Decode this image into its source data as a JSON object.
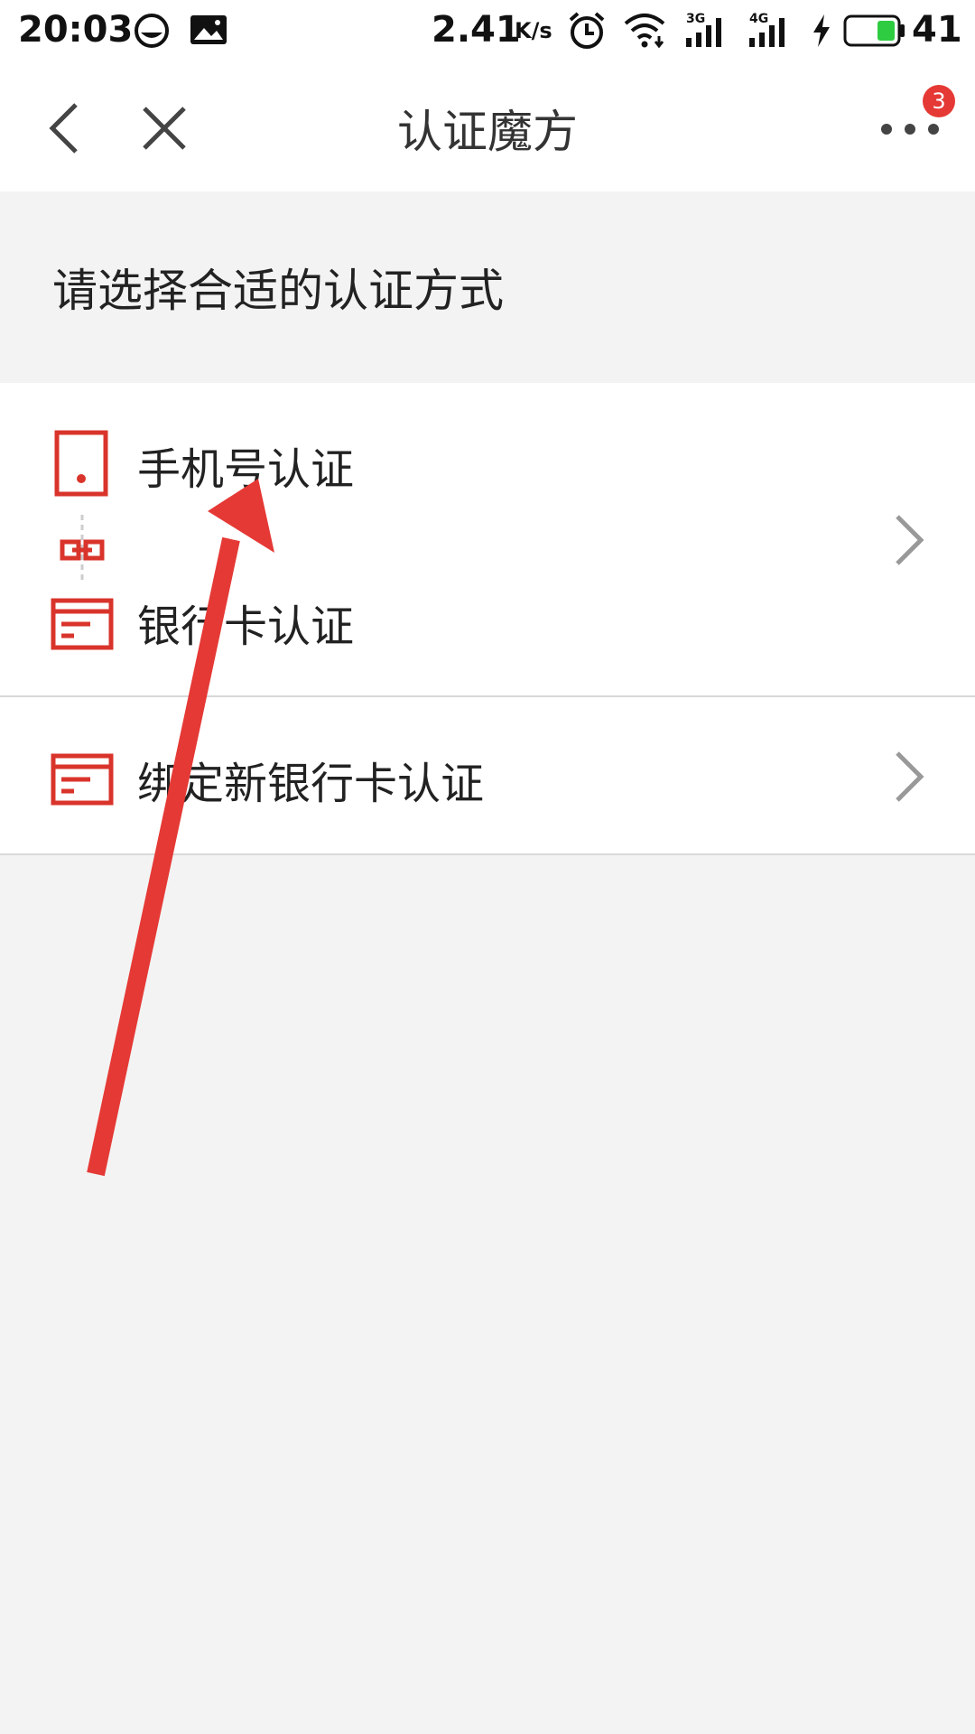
{
  "status_bar": {
    "time": "20:03",
    "network_speed": "2.41",
    "speed_unit": "K/s",
    "signal_1_label": "3G",
    "signal_2_label": "4G",
    "battery_percent": "41",
    "icons": [
      "app-notification-icon",
      "image-notification-icon",
      "alarm-icon",
      "wifi-icon",
      "signal-3g-icon",
      "signal-4g-icon",
      "charging-icon",
      "battery-icon"
    ],
    "battery_color": "#2ecc40"
  },
  "nav": {
    "title": "认证魔方",
    "more_badge": "3",
    "badge_color": "#e53935"
  },
  "prompt": {
    "text": "请选择合适的认证方式"
  },
  "options": [
    {
      "label_1": "手机号认证",
      "label_2": "银行卡认证",
      "icons": [
        "phone-icon",
        "link-icon",
        "bank-card-icon",
        "chevron-right-icon"
      ]
    },
    {
      "label": "绑定新银行卡认证",
      "icons": [
        "bank-card-icon",
        "chevron-right-icon"
      ]
    }
  ],
  "theme": {
    "accent": "#d9342b",
    "arrow_annotation": "#e53935",
    "background": "#f3f3f3"
  }
}
